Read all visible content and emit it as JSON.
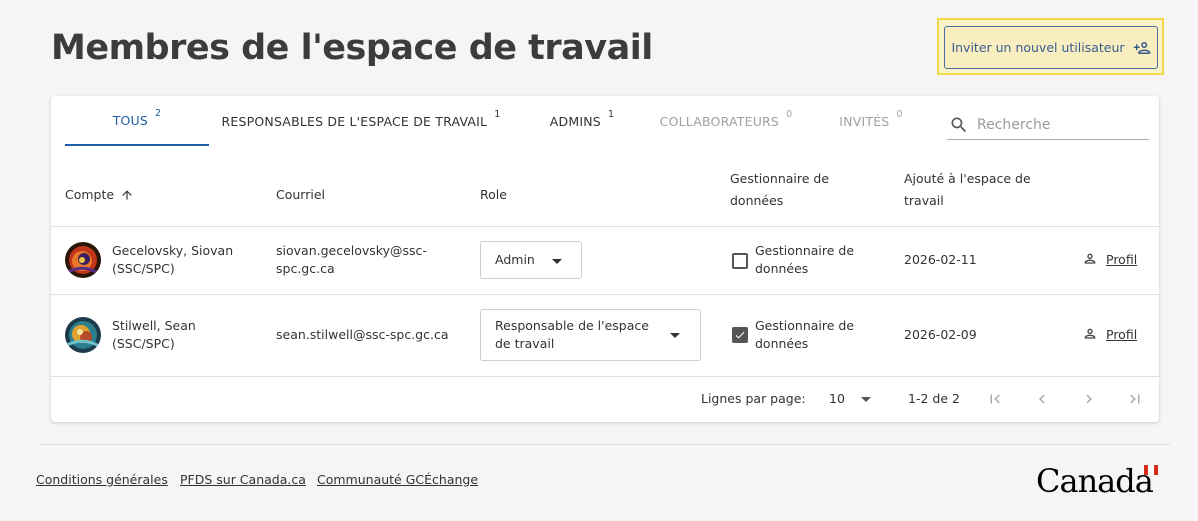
{
  "header": {
    "title": "Membres de l'espace de travail",
    "invite_button_label": "Inviter un nouvel utilisateur"
  },
  "tabs": [
    {
      "label": "TOUS",
      "count": "2",
      "active": true
    },
    {
      "label": "RESPONSABLES DE L'ESPACE DE TRAVAIL",
      "count": "1"
    },
    {
      "label": "ADMINS",
      "count": "1"
    },
    {
      "label": "COLLABORATEURS",
      "count": "0"
    },
    {
      "label": "INVITÉS",
      "count": "0"
    }
  ],
  "search": {
    "placeholder": "Recherche"
  },
  "table": {
    "columns": {
      "account": "Compte",
      "email": "Courriel",
      "role": "Role",
      "data_manager": "Gestionnaire de données",
      "added": "Ajouté à l'espace de travail"
    },
    "rows": [
      {
        "name": "Gecelovsky, Siovan (SSC/SPC)",
        "email": "siovan.gecelovsky@ssc-spc.gc.ca",
        "role": "Admin",
        "data_manager_label": "Gestionnaire de données",
        "data_manager_checked": false,
        "added": "2026-02-11",
        "profile_label": "Profil"
      },
      {
        "name": "Stilwell, Sean (SSC/SPC)",
        "email": "sean.stilwell@ssc-spc.gc.ca",
        "role": "Responsable de l'espace de travail",
        "data_manager_label": "Gestionnaire de données",
        "data_manager_checked": true,
        "added": "2026-02-09",
        "profile_label": "Profil"
      }
    ]
  },
  "pagination": {
    "rows_per_page_label": "Lignes par page:",
    "rows_per_page": "10",
    "range": "1-2 de 2"
  },
  "footer": {
    "links": [
      "Conditions générales",
      "PFDS sur Canada.ca",
      "Communauté GCÉchange"
    ],
    "wordmark": "Canada"
  },
  "colors": {
    "accent": "#1f5fa8",
    "highlight_border": "#f0d84a",
    "highlight_bg": "#fbf4c8",
    "flag_red": "#d52b1e"
  },
  "icons": {
    "invite": "person-add-icon",
    "search": "search-icon",
    "sort": "arrow-up-icon",
    "select": "caret-down-icon",
    "checkbox": "check-icon",
    "profile": "person-icon",
    "first": "first-page-icon",
    "prev": "chevron-left-icon",
    "next": "chevron-right-icon",
    "last": "last-page-icon"
  }
}
